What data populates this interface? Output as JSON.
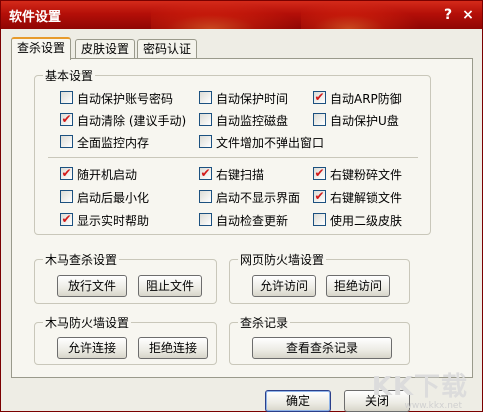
{
  "window": {
    "title": "软件设置",
    "help_button": "?",
    "close_button": "×"
  },
  "tabs": [
    {
      "label": "查杀设置",
      "active": true
    },
    {
      "label": "皮肤设置",
      "active": false
    },
    {
      "label": "密码认证",
      "active": false
    }
  ],
  "basic": {
    "title": "基本设置",
    "rows1": [
      {
        "label": "自动保护账号密码",
        "checked": false
      },
      {
        "label": "自动保护时间",
        "checked": false
      },
      {
        "label": "自动ARP防御",
        "checked": true
      },
      {
        "label": "自动清除 (建议手动)",
        "checked": true
      },
      {
        "label": "自动监控磁盘",
        "checked": false
      },
      {
        "label": "自动保护U盘",
        "checked": false
      },
      {
        "label": "全面监控内存",
        "checked": false
      },
      {
        "label": "文件增加不弹出窗口",
        "checked": false
      }
    ],
    "rows2": [
      {
        "label": "随开机启动",
        "checked": true
      },
      {
        "label": "右键扫描",
        "checked": true
      },
      {
        "label": "右键粉碎文件",
        "checked": true
      },
      {
        "label": "启动后最小化",
        "checked": false
      },
      {
        "label": "启动不显示界面",
        "checked": false
      },
      {
        "label": "右键解锁文件",
        "checked": true
      },
      {
        "label": "显示实时帮助",
        "checked": true
      },
      {
        "label": "自动检查更新",
        "checked": false
      },
      {
        "label": "使用二级皮肤",
        "checked": false
      }
    ]
  },
  "trojan_scan": {
    "title": "木马查杀设置",
    "buttons": [
      "放行文件",
      "阻止文件"
    ]
  },
  "web_firewall": {
    "title": "网页防火墙设置",
    "buttons": [
      "允许访问",
      "拒绝访问"
    ]
  },
  "trojan_firewall": {
    "title": "木马防火墙设置",
    "buttons": [
      "允许连接",
      "拒绝连接"
    ]
  },
  "scan_log": {
    "title": "查杀记录",
    "button": "查看查杀记录"
  },
  "footer": {
    "ok": "确定",
    "close": "关闭"
  },
  "watermark": {
    "main": "KK下载",
    "sub": "www.kkx.net"
  }
}
